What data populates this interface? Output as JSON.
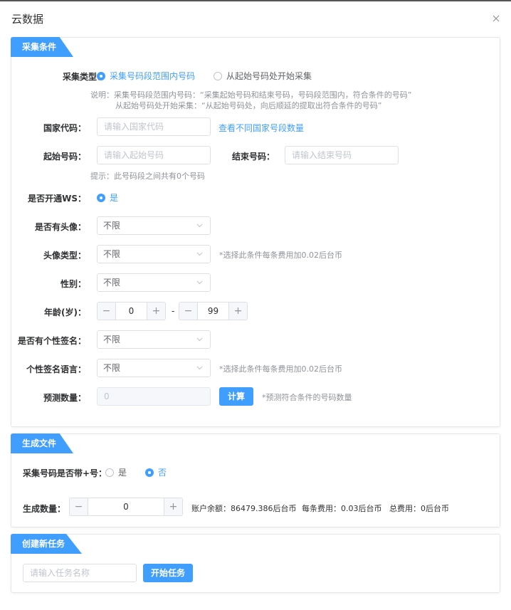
{
  "dialog": {
    "title": "云数据"
  },
  "collect": {
    "section_title": "采集条件",
    "type_label": "采集类型：",
    "type_options": [
      "采集号码段范围内号码",
      "从起始号码处开始采集"
    ],
    "desc_line1": "说明：采集号码段范围内号码：“采集起始号码和结束号码，号码段范围内，符合条件的号码”",
    "desc_line2": "从起始号码处开始采集：“从起始号码处，向后顺延的提取出符合条件的号码”",
    "country_label": "国家代码：",
    "country_placeholder": "请输入国家代码",
    "country_link": "查看不同国家号段数量",
    "start_label": "起始号码：",
    "start_placeholder": "请输入起始号码",
    "end_label": "结束号码：",
    "end_placeholder": "请输入结束号码",
    "range_hint": "提示：此号码段之间共有0个号码",
    "ws_label": "是否开通WS：",
    "ws_option": "是",
    "avatar_label": "是否有头像：",
    "avatar_value": "不限",
    "avatar_type_label": "头像类型：",
    "avatar_type_value": "不限",
    "avatar_type_note": "*选择此条件每条费用加0.02后台币",
    "gender_label": "性别：",
    "gender_value": "不限",
    "age_label": "年龄(岁)：",
    "age_min": "0",
    "age_sep": "-",
    "age_max": "99",
    "signature_label": "是否有个性签名：",
    "signature_value": "不限",
    "sig_lang_label": "个性签名语言：",
    "sig_lang_value": "不限",
    "sig_lang_note": "*选择此条件每条费用加0.02后台币",
    "predict_label": "预测数量：",
    "predict_value": "0",
    "calc_button": "计算",
    "predict_note": "*预测符合条件的号码数量"
  },
  "generate": {
    "section_title": "生成文件",
    "plus_label": "采集号码是否带+号：",
    "plus_options": [
      "是",
      "否"
    ],
    "count_label": "生成数量：",
    "count_value": "0",
    "balance": "账户余额：86479.386后台币",
    "unit_fee": "每条费用：0.03后台币",
    "total_fee": "总费用：0后台币"
  },
  "task": {
    "section_title": "创建新任务",
    "name_placeholder": "请输入任务名称",
    "start_button": "开始任务"
  },
  "colors": {
    "accent": "#409eff",
    "text": "#303133",
    "muted": "#909399"
  }
}
